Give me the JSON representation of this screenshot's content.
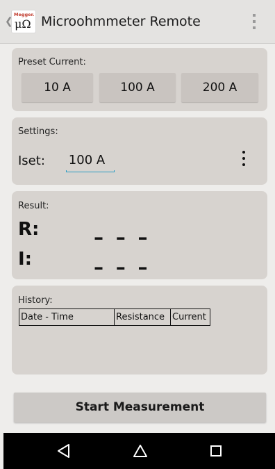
{
  "app": {
    "title": "Microohmmeter Remote",
    "logo_brand": "Megger.",
    "logo_symbol": "μΩ"
  },
  "preset": {
    "label": "Preset Current:",
    "buttons": [
      "10 A",
      "100 A",
      "200 A"
    ]
  },
  "settings": {
    "label": "Settings:",
    "iset_label": "Iset:",
    "iset_value": "100 A"
  },
  "result": {
    "label": "Result:",
    "r_label": "R:",
    "r_value": "– – –",
    "i_label": "I:",
    "i_value": "– – –"
  },
  "history": {
    "label": "History:",
    "columns": [
      "Date - Time",
      "Resistance",
      "Current"
    ]
  },
  "actions": {
    "start_label": "Start Measurement"
  },
  "icons": {
    "back": "chevron-left-icon",
    "overflow": "overflow-menu-icon",
    "settings_menu": "more-vert-icon",
    "nav_back": "triangle-back-icon",
    "nav_home": "home-circle-icon",
    "nav_recents": "square-recents-icon"
  }
}
